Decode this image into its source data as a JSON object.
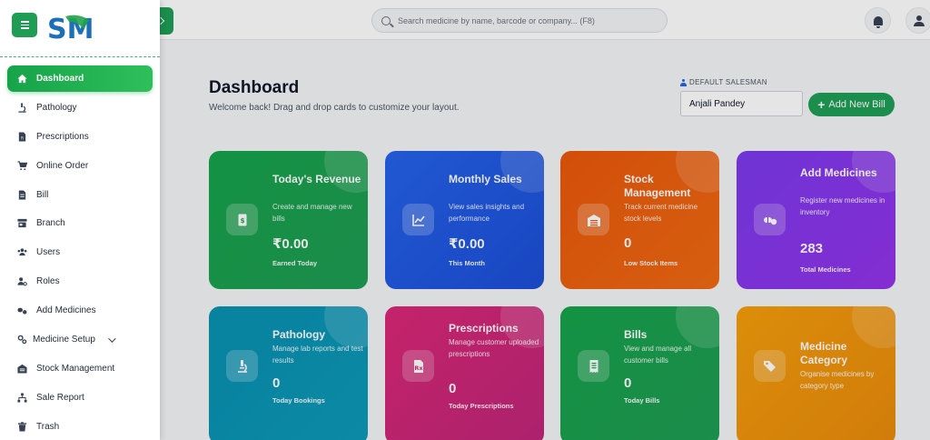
{
  "topbar": {
    "search_placeholder": "Search medicine by name, barcode or company... (F8)",
    "icons": {
      "notifications": "bell-icon",
      "profile": "user-icon",
      "search": "search-icon"
    }
  },
  "header": {
    "title": "Dashboard",
    "subtitle": "Welcome back! Drag and drop cards to customize your layout.",
    "salesman_label": "DEFAULT SALESMAN",
    "salesman_value": "Anjali Pandey",
    "add_bill_label": "Add New Bill"
  },
  "cards": [
    {
      "title": "Today's Revenue",
      "desc": "Create and manage new bills",
      "value": "₹0.00",
      "foot": "Earned Today",
      "color": "#16a34a",
      "icon": "bill-dollar-icon"
    },
    {
      "title": "Monthly Sales",
      "desc": "View sales insights and performance",
      "value": "₹0.00",
      "foot": "This Month",
      "color": "#2563eb",
      "icon": "chart-line-icon"
    },
    {
      "title": "Stock Management",
      "desc": "Track current medicine stock levels",
      "value": "0",
      "foot": "Low Stock Items",
      "color": "#ea580c",
      "icon": "warehouse-icon"
    },
    {
      "title": "Add Medicines",
      "desc": "Register new medicines in inventory",
      "value": "283",
      "foot": "Total Medicines",
      "color": "#7c3aed",
      "icon": "pills-icon"
    },
    {
      "title": "Pathology",
      "desc": "Manage lab reports and test results",
      "value": "0",
      "foot": "Today Bookings",
      "color": "#0891b2",
      "icon": "microscope-icon"
    },
    {
      "title": "Prescriptions",
      "desc": "Manage customer uploaded prescriptions",
      "value": "0",
      "foot": "Today Prescriptions",
      "color": "#db2777",
      "icon": "prescription-icon"
    },
    {
      "title": "Bills",
      "desc": "View and manage all customer bills",
      "value": "0",
      "foot": "Today Bills",
      "color": "#16a34a",
      "icon": "receipt-icon"
    },
    {
      "title": "Medicine Category",
      "desc": "Organise medicines by category type",
      "value": "",
      "foot": "",
      "color": "#f59e0b",
      "icon": "tags-icon"
    }
  ],
  "sidebar": {
    "logo_text": "SM",
    "items": [
      {
        "label": "Dashboard",
        "icon": "home-icon",
        "active": true
      },
      {
        "label": "Pathology",
        "icon": "microscope-icon"
      },
      {
        "label": "Prescriptions",
        "icon": "file-prescription-icon"
      },
      {
        "label": "Online Order",
        "icon": "cart-icon"
      },
      {
        "label": "Bill",
        "icon": "file-invoice-icon"
      },
      {
        "label": "Branch",
        "icon": "store-icon"
      },
      {
        "label": "Users",
        "icon": "users-icon"
      },
      {
        "label": "Roles",
        "icon": "user-cog-icon"
      },
      {
        "label": "Add Medicines",
        "icon": "pills-icon"
      },
      {
        "label": "Medicine Setup",
        "icon": "cogs-icon",
        "has_dropdown": true
      },
      {
        "label": "Stock Management",
        "icon": "warehouse-icon"
      },
      {
        "label": "Sale Report",
        "icon": "sitemap-icon"
      },
      {
        "label": "Trash",
        "icon": "trash-icon"
      }
    ]
  }
}
